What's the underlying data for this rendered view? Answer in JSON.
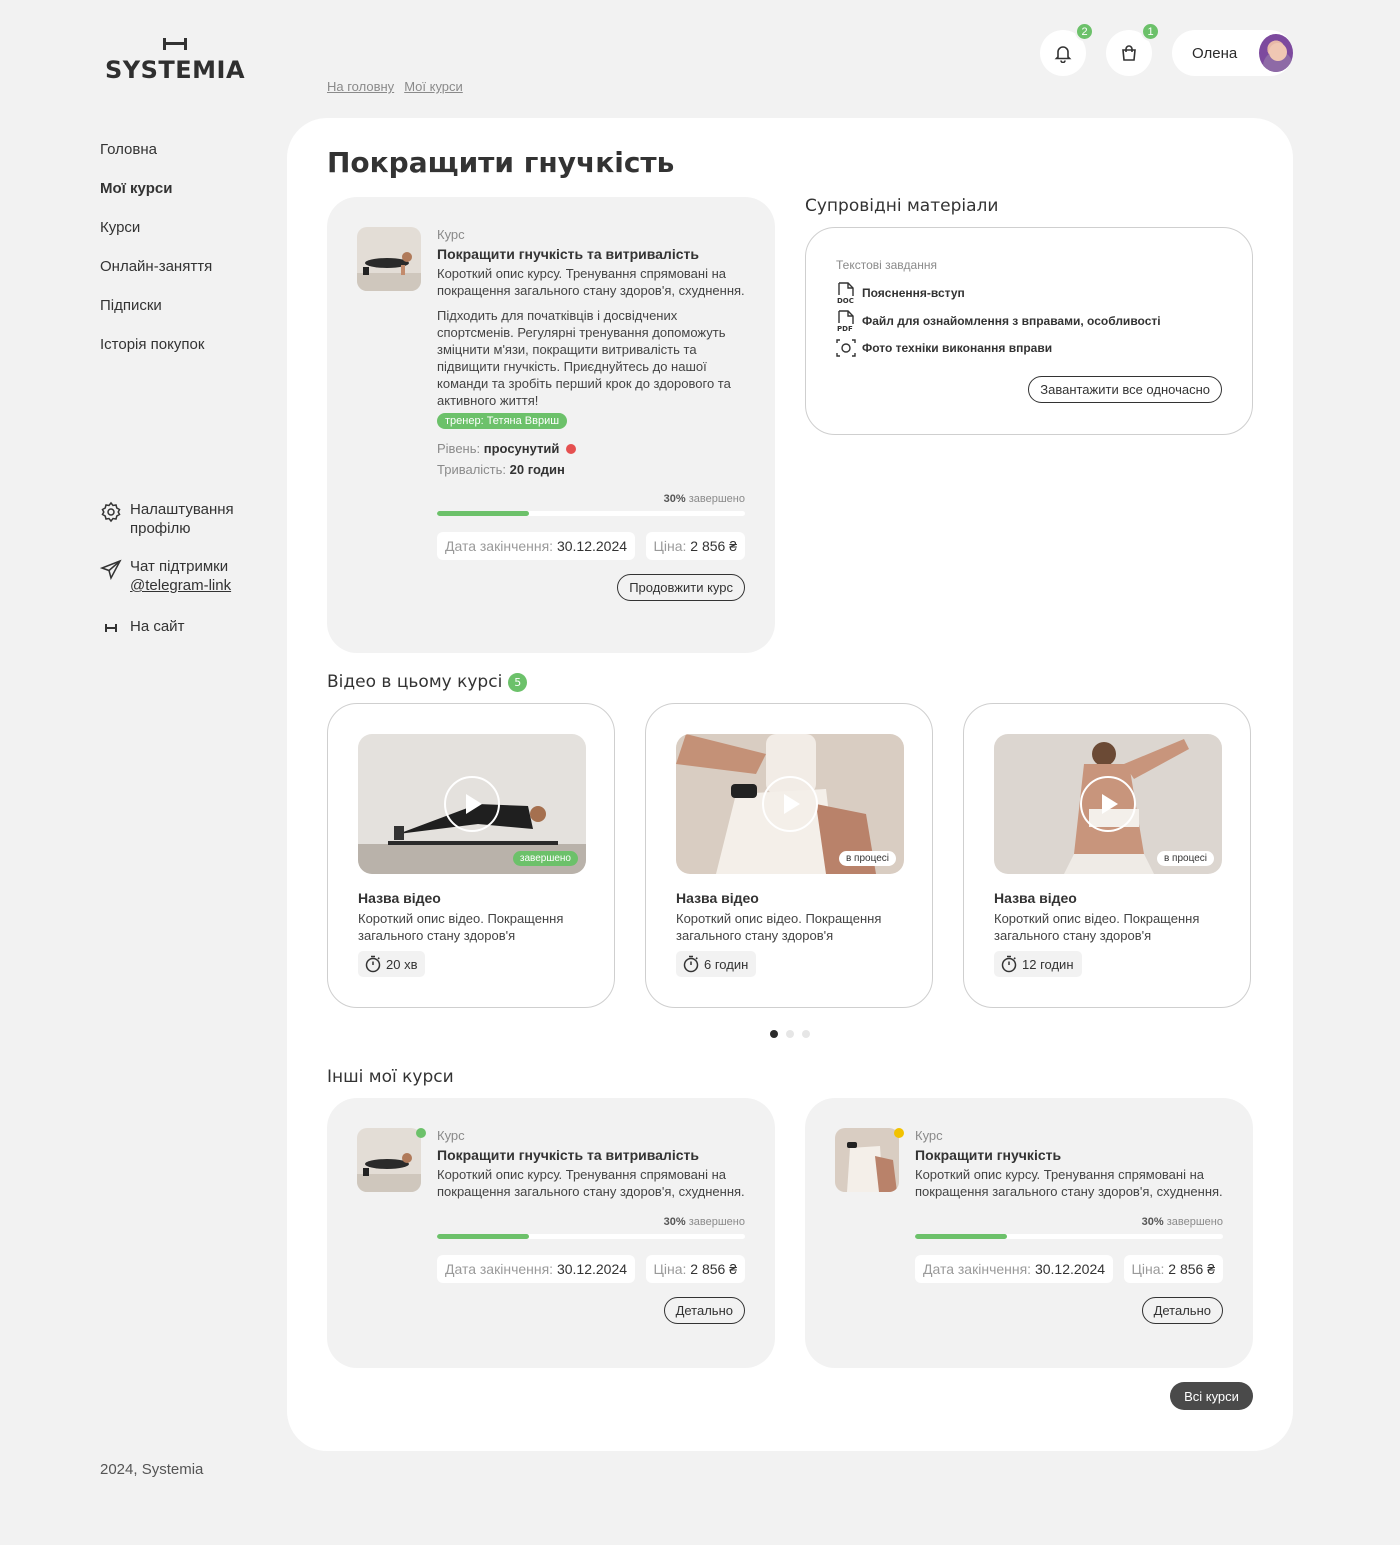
{
  "brand": {
    "name": "SYSTEMIA"
  },
  "breadcrumb": [
    "На головну",
    "Мої курси"
  ],
  "header": {
    "notifications_count": "2",
    "cart_count": "1",
    "user_name": "Олена"
  },
  "sidebar": {
    "items": [
      {
        "label": "Головна",
        "active": false
      },
      {
        "label": "Мої курси",
        "active": true
      },
      {
        "label": "Курси",
        "active": false
      },
      {
        "label": "Онлайн-заняття",
        "active": false
      },
      {
        "label": "Підписки",
        "active": false
      },
      {
        "label": "Історія покупок",
        "active": false
      }
    ],
    "settings_label": "Налаштування профілю",
    "support_label": "Чат підтримки",
    "support_link": "@telegram-link",
    "site_label": "На сайт"
  },
  "footer": {
    "text": "2024, Systemia"
  },
  "page": {
    "title": "Покращити гнучкість"
  },
  "main_course": {
    "kicker": "Курс",
    "title": "Покращити гнучкість та витривалість",
    "desc1": "Короткий опис курсу. Тренування спрямовані на покращення загального стану здоров'я, схуднення.",
    "desc2": "Підходить для початківців і досвідчених спортсменів. Регулярні тренування допоможуть зміцнити м'язи, покращити витривалість та підвищити гнучкість. Приєднуйтесь до нашої команди та зробіть перший крок до здорового та активного життя!",
    "trainer": "тренер: Тетяна Ввриш",
    "level_label": "Рівень:",
    "level_value": "просунутий",
    "duration_label": "Тривалість:",
    "duration_value": "20 годин",
    "progress_value": "30%",
    "progress_suffix": "завершено",
    "progress_fraction": 0.3,
    "end_label": "Дата закінчення:",
    "end_value": "30.12.2024",
    "price_label": "Ціна:",
    "price_value": "2 856 ₴",
    "button": "Продовжити курс"
  },
  "materials": {
    "title": "Супровідні матеріали",
    "kicker": "Текстові завдання",
    "items": [
      {
        "label": "Пояснення-вступ",
        "icon": "doc-file-icon"
      },
      {
        "label": "Файл для ознайомлення з вправами, особливості",
        "icon": "pdf-file-icon"
      },
      {
        "label": "Фото техніки виконання вправи",
        "icon": "camera-icon"
      }
    ],
    "download_button": "Завантажити все одночасно"
  },
  "videos": {
    "title": "Відео в цьому курсі",
    "count": "5",
    "items": [
      {
        "title": "Назва відео",
        "desc": "Короткий опис відео. Покращення загального стану здоров'я",
        "duration": "20 хв",
        "status": "завершено"
      },
      {
        "title": "Назва відео",
        "desc": "Короткий опис відео. Покращення загального стану здоров'я",
        "duration": "6 годин",
        "status": "в процесі"
      },
      {
        "title": "Назва відео",
        "desc": "Короткий опис відео. Покращення загального стану здоров'я",
        "duration": "12 годин",
        "status": "в процесі"
      }
    ],
    "pagination_pages": 3,
    "pagination_active": 1
  },
  "other_courses": {
    "title": "Інші мої курси",
    "items": [
      {
        "kicker": "Курс",
        "title": "Покращити гнучкість та витривалість",
        "desc": "Короткий опис курсу. Тренування спрямовані на покращення загального стану здоров'я, схуднення.",
        "progress_value": "30%",
        "progress_suffix": "завершено",
        "progress_fraction": 0.3,
        "end_label": "Дата закінчення:",
        "end_value": "30.12.2024",
        "price_label": "Ціна:",
        "price_value": "2 856 ₴",
        "button": "Детально",
        "status_color": "#6cc16a"
      },
      {
        "kicker": "Курс",
        "title": "Покращити гнучкість",
        "desc": "Короткий опис курсу. Тренування спрямовані на покращення загального стану здоров'я, схуднення.",
        "progress_value": "30%",
        "progress_suffix": "завершено",
        "progress_fraction": 0.3,
        "end_label": "Дата закінчення:",
        "end_value": "30.12.2024",
        "price_label": "Ціна:",
        "price_value": "2 856 ₴",
        "button": "Детально",
        "status_color": "#f2c200"
      }
    ],
    "all_button": "Всі курси"
  },
  "colors": {
    "accent": "#6cc16a",
    "background": "#f2f2f2",
    "dark": "#2b2b2b",
    "danger": "#e55050",
    "warning": "#f2c200"
  }
}
